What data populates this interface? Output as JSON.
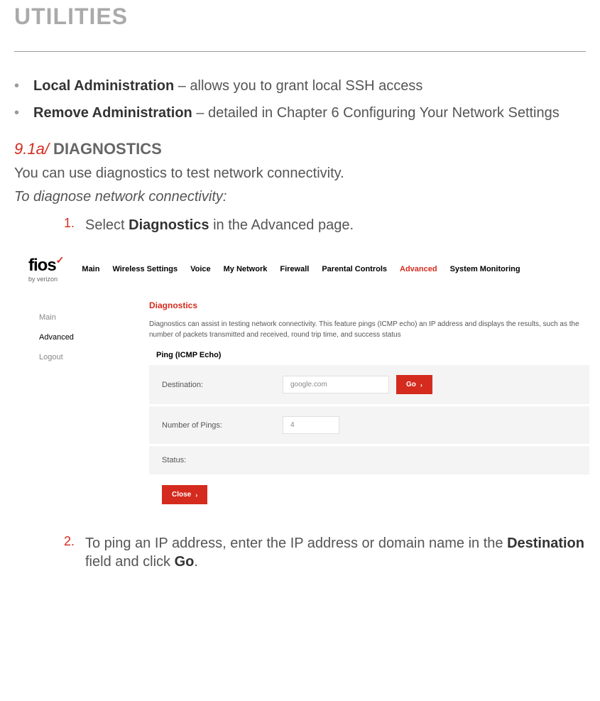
{
  "page_title": "UTILITIES",
  "bullets": [
    {
      "bold": "Local Administration",
      "rest": " – allows you to grant local SSH access"
    },
    {
      "bold": "Remove Administration",
      "rest": " – detailed in Chapter 6 Configuring Your Network Settings"
    }
  ],
  "section": {
    "num": "9.1a/",
    "title": " DIAGNOSTICS",
    "intro": "You can use diagnostics to test network connectivity.",
    "sub": "To diagnose network connectivity:"
  },
  "steps": {
    "1": {
      "num": "1.",
      "pre": "Select ",
      "bold": "Diagnostics",
      "post": " in the Advanced page."
    },
    "2": {
      "num": "2.",
      "text_a": "To ping an IP address, enter the IP address or domain name in the ",
      "bold_a": "Destination",
      "text_b": " field and click ",
      "bold_b": "Go",
      "text_c": "."
    }
  },
  "app": {
    "logo": {
      "main": "fios",
      "check": "✓",
      "sub": "by verizon"
    },
    "nav": [
      "Main",
      "Wireless Settings",
      "Voice",
      "My Network",
      "Firewall",
      "Parental Controls",
      "Advanced",
      "System Monitoring"
    ],
    "nav_active_index": 6,
    "sidebar": [
      "Main",
      "Advanced",
      "Logout"
    ],
    "sidebar_active_index": 1,
    "panel": {
      "title": "Diagnostics",
      "desc": "Diagnostics can assist in testing network connectivity. This feature pings (ICMP echo) an IP address and displays the results, such as the number of packets transmitted and received, round trip time, and success status",
      "ping_label": "Ping (ICMP Echo)",
      "destination_label": "Destination:",
      "destination_value": "google.com",
      "go_label": "Go",
      "num_pings_label": "Number of Pings:",
      "num_pings_value": "4",
      "status_label": "Status:",
      "close_label": "Close"
    }
  }
}
